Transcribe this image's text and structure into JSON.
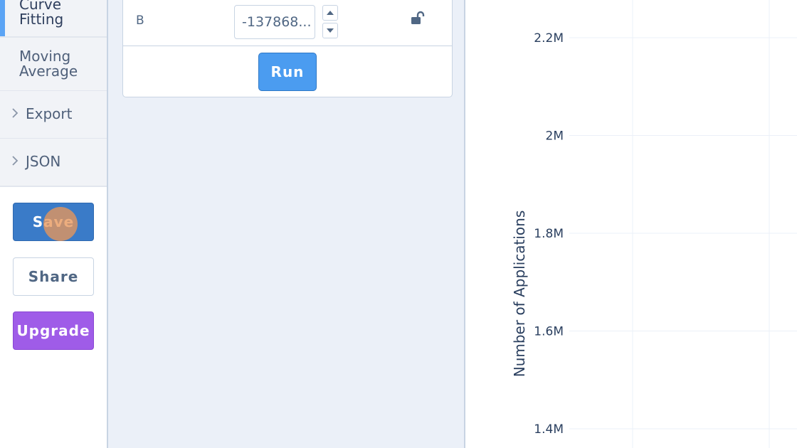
{
  "sidebar": {
    "active_item": "Curve\nFitting",
    "moving_average": "Moving\nAverage",
    "export_label": "Export",
    "json_label": "JSON",
    "save_label": "Save",
    "share_label": "Share",
    "upgrade_label": "Upgrade"
  },
  "panel": {
    "param_name": "B",
    "param_value": "-137868...",
    "run_label": "Run"
  },
  "chart_data": {
    "type": "line",
    "ylabel": "Number of Applications",
    "yticks": [
      "2.2M",
      "2M",
      "1.8M",
      "1.6M",
      "1.4M"
    ],
    "ytick_values": [
      2200000,
      2000000,
      1800000,
      1600000,
      1400000
    ],
    "series": []
  },
  "colors": {
    "accent": "#5ba4f5",
    "save": "#3a7bc8",
    "upgrade": "#9f5ce8",
    "run": "#4b9cf0",
    "panel_bg": "#ebf0f8"
  }
}
